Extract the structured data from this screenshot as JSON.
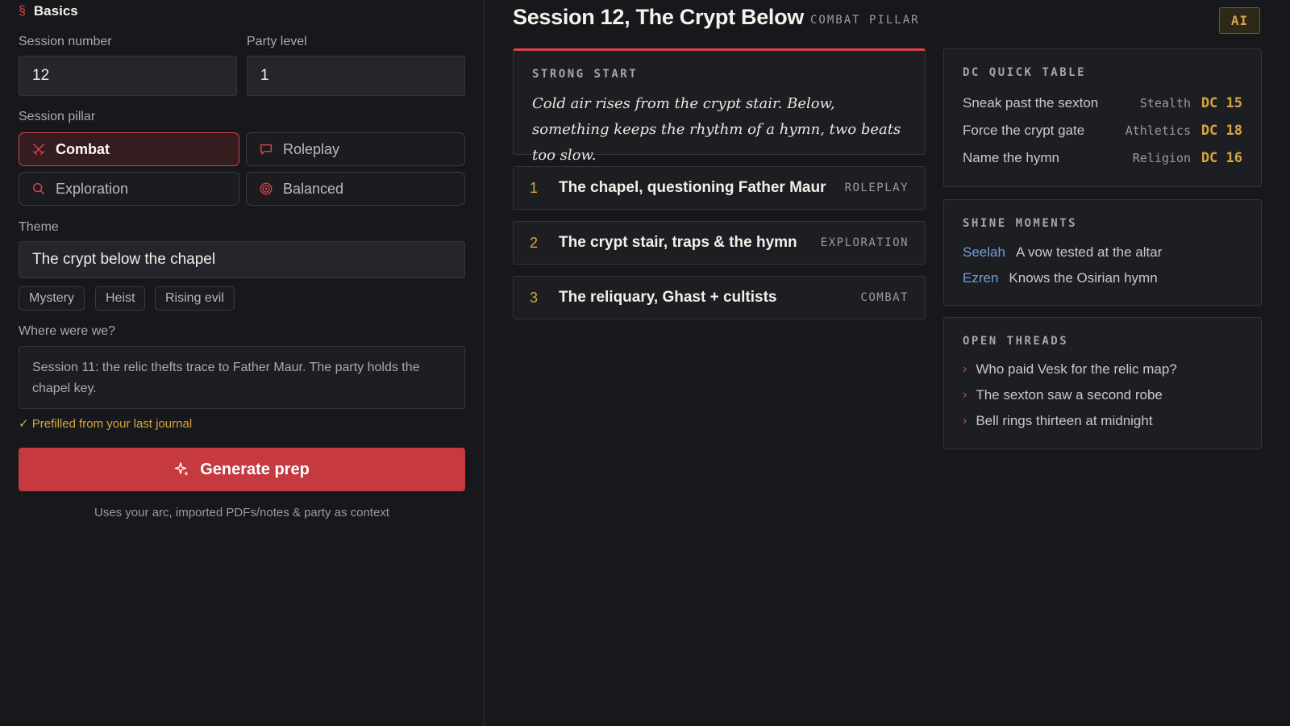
{
  "basics": {
    "section_mark": "§",
    "section_title": "Basics",
    "session_number_label": "Session number",
    "session_number_value": "12",
    "party_level_label": "Party level",
    "party_level_value": "1",
    "pillar_label": "Session pillar",
    "pillars": [
      {
        "label": "Combat",
        "icon": "crossed-swords-icon",
        "active": true
      },
      {
        "label": "Roleplay",
        "icon": "speech-bubble-icon",
        "active": false
      },
      {
        "label": "Exploration",
        "icon": "magnifier-icon",
        "active": false
      },
      {
        "label": "Balanced",
        "icon": "target-icon",
        "active": false
      }
    ],
    "theme_label": "Theme",
    "theme_value": "The crypt below the chapel",
    "theme_chips": [
      "Mystery",
      "Heist",
      "Rising evil"
    ],
    "where_label": "Where were we?",
    "where_value": "Session 11: the relic thefts trace to Father Maur. The party holds the chapel key.",
    "prefill_note": "✓ Prefilled from your last journal",
    "generate_label": "Generate prep",
    "hint": "Uses your arc, imported PDFs/notes & party as context"
  },
  "prep": {
    "title": "Session 12, The Crypt Below",
    "pillar_tag": "COMBAT PILLAR",
    "ai_badge": "AI",
    "strong_start_heading": "STRONG START",
    "strong_start_text": "Cold air rises from the crypt stair. Below, something keeps the rhythm of a hymn, two beats too slow.",
    "scenes": [
      {
        "num": "1",
        "name": "The chapel, questioning Father Maur",
        "kind": "ROLEPLAY"
      },
      {
        "num": "2",
        "name": "The crypt stair, traps & the hymn",
        "kind": "EXPLORATION"
      },
      {
        "num": "3",
        "name": "The reliquary, Ghast + cultists",
        "kind": "COMBAT"
      }
    ],
    "dc_heading": "DC QUICK TABLE",
    "dc_rows": [
      {
        "task": "Sneak past the sexton",
        "skill": "Stealth",
        "dc": "DC 15"
      },
      {
        "task": "Force the crypt gate",
        "skill": "Athletics",
        "dc": "DC 18"
      },
      {
        "task": "Name the hymn",
        "skill": "Religion",
        "dc": "DC 16"
      }
    ],
    "shine_heading": "SHINE MOMENTS",
    "shine_rows": [
      {
        "who": "Seelah",
        "what": "A vow tested at the altar"
      },
      {
        "who": "Ezren",
        "what": "Knows the Osirian hymn"
      }
    ],
    "threads_heading": "OPEN THREADS",
    "threads": [
      "Who paid Vesk for the relic map?",
      "The sexton saw a second robe",
      "Bell rings thirteen at midnight"
    ]
  },
  "colors": {
    "accent_red": "#d9434a",
    "accent_gold": "#d6a640",
    "link_blue": "#6f9fd8",
    "background": "#17181b"
  }
}
